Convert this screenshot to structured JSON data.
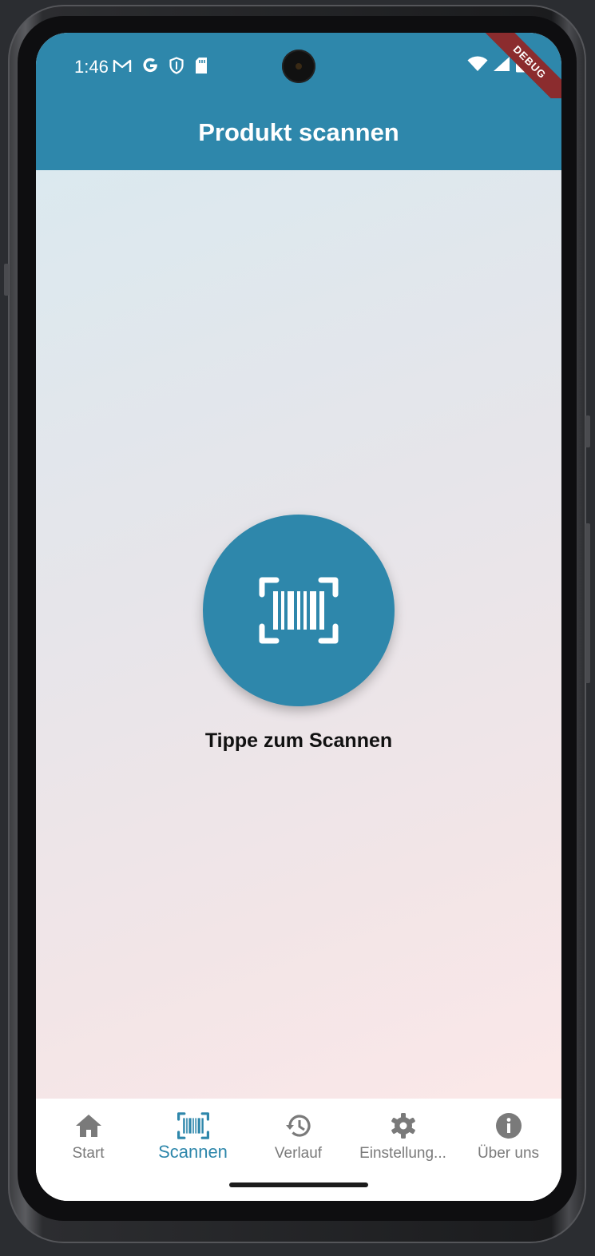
{
  "status_bar": {
    "time": "1:46",
    "left_icons": [
      "gmail-icon",
      "google-icon",
      "shield-icon",
      "sd-card-icon"
    ],
    "right_icons": [
      "wifi-icon",
      "signal-icon",
      "battery-icon"
    ]
  },
  "debug_banner": "DEBUG",
  "app_bar": {
    "title": "Produkt scannen"
  },
  "main": {
    "scan_button_icon": "barcode-scan-icon",
    "scan_label": "Tippe zum Scannen"
  },
  "bottom_nav": {
    "items": [
      {
        "label": "Start",
        "icon": "home-icon",
        "active": false
      },
      {
        "label": "Scannen",
        "icon": "barcode-scan-icon",
        "active": true
      },
      {
        "label": "Verlauf",
        "icon": "history-icon",
        "active": false
      },
      {
        "label": "Einstellung...",
        "icon": "gear-icon",
        "active": false
      },
      {
        "label": "Über uns",
        "icon": "info-icon",
        "active": false
      }
    ]
  },
  "colors": {
    "primary": "#2e87ab",
    "nav_inactive": "#7a7a7a",
    "debug": "#8b2c2e"
  }
}
